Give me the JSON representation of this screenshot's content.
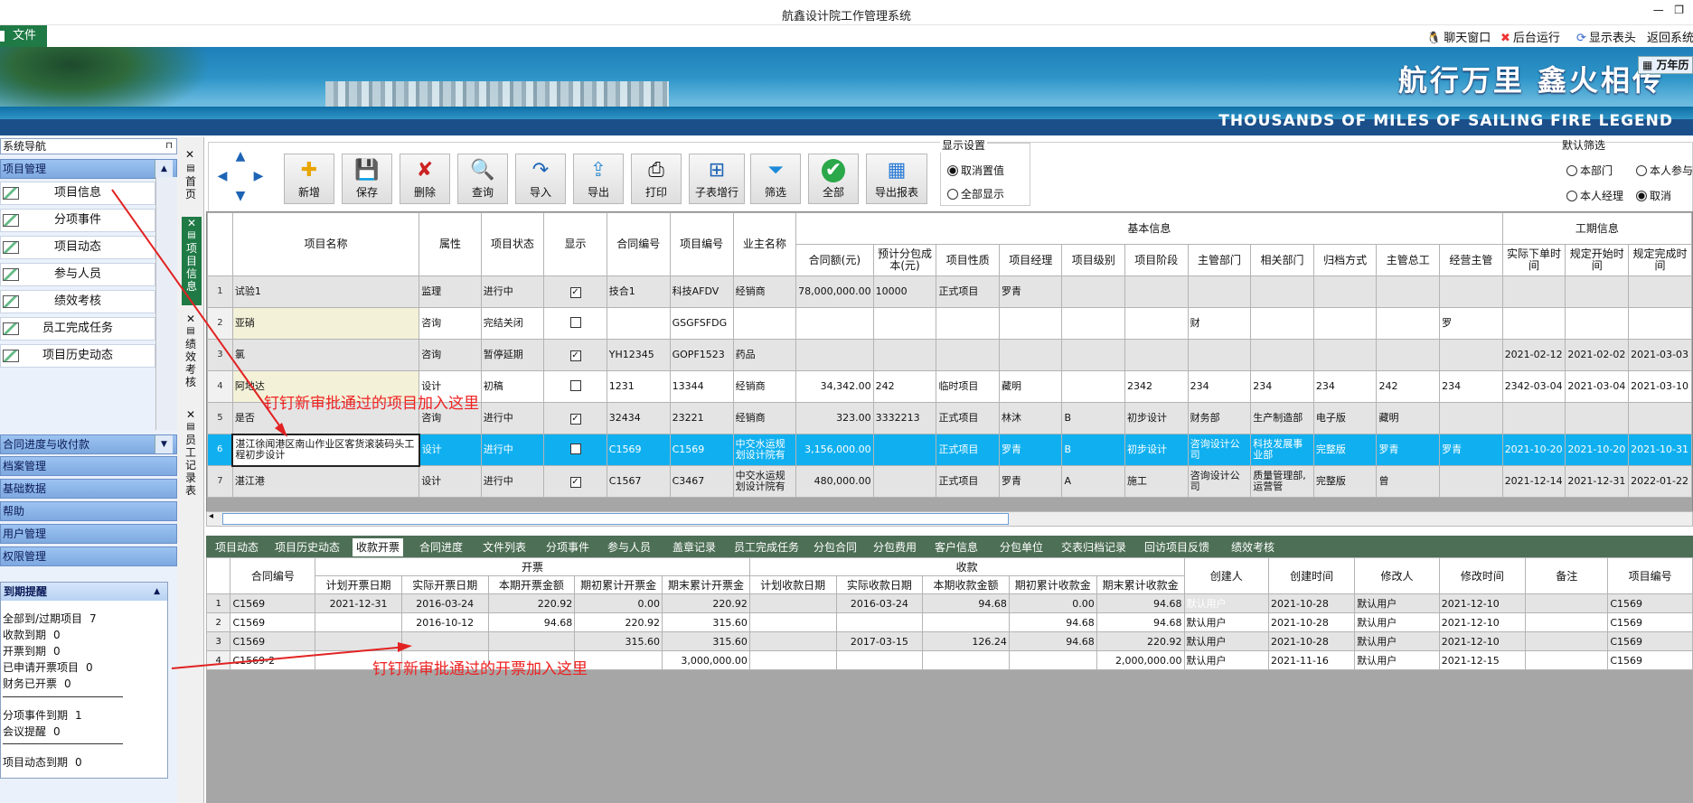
{
  "window": {
    "title": "航鑫设计院工作管理系统"
  },
  "menu": {
    "file": "文件"
  },
  "topbar": {
    "chat": "聊天窗口",
    "background_run": "后台运行",
    "show_header": "显示表头",
    "back_system": "返回系统",
    "calendar": "万年历"
  },
  "banner": {
    "slogan": "航行万里 鑫火相传",
    "slogan_en": "THOUSANDS OF MILES OF SAILING FIRE LEGEND"
  },
  "nav": {
    "header": "系统导航",
    "group_project": "项目管理",
    "items": [
      "项目信息",
      "分项事件",
      "项目动态",
      "参与人员",
      "绩效考核",
      "员工完成任务",
      "项目历史动态"
    ],
    "groups_bottom": [
      "合同进度与收付款",
      "档案管理",
      "基础数据",
      "帮助",
      "用户管理",
      "权限管理"
    ]
  },
  "reminder": {
    "title": "到期提醒",
    "rows": [
      {
        "label": "全部到/过期项目",
        "value": "7"
      },
      {
        "label": "收款到期",
        "value": "0"
      },
      {
        "label": "开票到期",
        "value": "0"
      },
      {
        "label": "已申请开票项目",
        "value": "0"
      },
      {
        "label": "财务已开票",
        "value": "0"
      },
      {
        "label": "分项事件到期",
        "value": "1"
      },
      {
        "label": "会议提醒",
        "value": "0"
      },
      {
        "label": "项目动态到期",
        "value": "0"
      }
    ]
  },
  "vtabs": [
    "首页",
    "项目信息",
    "绩效考核",
    "员工记录表"
  ],
  "toolbar": {
    "buttons": [
      "新增",
      "保存",
      "删除",
      "查询",
      "导入",
      "导出",
      "打印",
      "子表增行",
      "筛选",
      "全部",
      "导出报表"
    ],
    "display_title": "显示设置",
    "display_opts": [
      "取消置值",
      "全部显示"
    ],
    "filter_title": "默认筛选",
    "filter_opts": [
      "本部门",
      "本人参与",
      "本人经理",
      "取消"
    ]
  },
  "grid": {
    "group_basic": "基本信息",
    "group_period": "工期信息",
    "headers": [
      "项目名称",
      "属性",
      "项目状态",
      "显示",
      "合同编号",
      "项目编号",
      "业主名称",
      "合同额(元)",
      "预计分包成本(元)",
      "项目性质",
      "项目经理",
      "项目级别",
      "项目阶段",
      "主管部门",
      "相关部门",
      "归档方式",
      "主管总工",
      "经营主管",
      "实际下单时间",
      "规定开始时间",
      "规定完成时间"
    ],
    "rows": [
      [
        "1",
        "试验1",
        "监理",
        "进行中",
        "✓",
        "技合1",
        "科技AFDV",
        "经销商",
        "78,000,000.00",
        "10000",
        "正式项目",
        "罗青",
        "",
        "",
        "",
        "",
        "",
        "",
        "",
        "",
        "",
        ""
      ],
      [
        "2",
        "亚硝",
        "咨询",
        "完结关闭",
        "",
        "",
        "GSGFSFDG",
        "",
        "",
        "",
        "",
        "",
        "",
        "",
        "财",
        "",
        "",
        "",
        "罗",
        "",
        "",
        ""
      ],
      [
        "3",
        "氯",
        "咨询",
        "暂停延期",
        "✓",
        "YH12345",
        "GOPF1523",
        "药品",
        "",
        "",
        "",
        "",
        "",
        "",
        "",
        "",
        "",
        "",
        "",
        "2021-02-12",
        "2021-02-02",
        "2021-03-03"
      ],
      [
        "4",
        "阿地达",
        "设计",
        "初稿",
        "",
        "1231",
        "13344",
        "经销商",
        "34,342.00",
        "242",
        "临时项目",
        "藏明",
        "",
        "2342",
        "234",
        "234",
        "234",
        "242",
        "234",
        "2342-03-04",
        "2021-03-04",
        "2021-03-10"
      ],
      [
        "5",
        "是否",
        "咨询",
        "进行中",
        "✓",
        "32434",
        "23221",
        "经销商",
        "323.00",
        "3332213",
        "正式项目",
        "林沐",
        "B",
        "初步设计",
        "财务部",
        "生产制造部",
        "电子版",
        "藏明",
        "",
        "",
        "",
        ""
      ],
      [
        "6",
        "湛江徐闻港区南山作业区客货滚装码头工程初步设计",
        "设计",
        "进行中",
        "",
        "C1569",
        "C1569",
        "中交水运规划设计院有",
        "3,156,000.00",
        "",
        "正式项目",
        "罗青",
        "B",
        "初步设计",
        "咨询设计公司",
        "科技发展事业部",
        "完整版",
        "罗青",
        "罗青",
        "2021-10-20",
        "2021-10-20",
        "2021-10-31"
      ],
      [
        "7",
        "湛江港",
        "设计",
        "进行中",
        "✓",
        "C1567",
        "C3467",
        "中交水运规划设计院有",
        "480,000.00",
        "",
        "正式项目",
        "罗青",
        "A",
        "施工",
        "咨询设计公司",
        "质量管理部,运营管",
        "完整版",
        "曾",
        "",
        "2021-12-14",
        "2021-12-31",
        "2022-01-22"
      ]
    ]
  },
  "bottom_tabs": [
    "项目动态",
    "项目历史动态",
    "收款开票",
    "合同进度",
    "文件列表",
    "分项事件",
    "参与人员",
    "盖章记录",
    "员工完成任务",
    "分包合同",
    "分包费用",
    "客户信息",
    "分包单位",
    "交表归档记录",
    "回访项目反馈",
    "绩效考核"
  ],
  "subgrid": {
    "group_invoice": "开票",
    "group_receive": "收款",
    "col_contract": "合同编号",
    "headers_invoice": [
      "计划开票日期",
      "实际开票日期",
      "本期开票金额",
      "期初累计开票金",
      "期末累计开票金"
    ],
    "headers_receive": [
      "计划收款日期",
      "实际收款日期",
      "本期收款金额",
      "期初累计收款金",
      "期末累计收款金"
    ],
    "headers_tail": [
      "创建人",
      "创建时间",
      "修改人",
      "修改时间",
      "备注",
      "项目编号"
    ],
    "rows": [
      [
        "1",
        "C1569",
        "2021-12-31",
        "2016-03-24",
        "220.92",
        "0.00",
        "220.92",
        "",
        "2016-03-24",
        "94.68",
        "0.00",
        "94.68",
        "默认用户",
        "2021-10-28",
        "默认用户",
        "2021-12-10",
        "",
        "C1569"
      ],
      [
        "2",
        "C1569",
        "",
        "2016-10-12",
        "94.68",
        "220.92",
        "315.60",
        "",
        "",
        "",
        "94.68",
        "94.68",
        "默认用户",
        "2021-10-28",
        "默认用户",
        "2021-12-10",
        "",
        "C1569"
      ],
      [
        "3",
        "C1569",
        "",
        "",
        "",
        "315.60",
        "315.60",
        "",
        "2017-03-15",
        "126.24",
        "94.68",
        "220.92",
        "默认用户",
        "2021-10-28",
        "默认用户",
        "2021-12-10",
        "",
        "C1569"
      ],
      [
        "4",
        "C1569-2",
        "",
        "",
        "",
        "",
        "3,000,000.00",
        "",
        "",
        "",
        "",
        "2,000,000.00",
        "默认用户",
        "2021-11-16",
        "默认用户",
        "2021-12-15",
        "",
        "C1569"
      ]
    ]
  },
  "annotations": {
    "note1": "钉钉新审批通过的项目加入这里",
    "note2": "钉钉新审批通过的开票加入这里",
    "color": "#e22222"
  }
}
